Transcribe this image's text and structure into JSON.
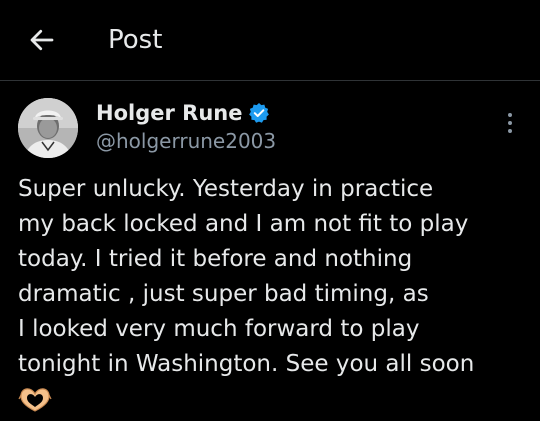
{
  "header": {
    "title": "Post",
    "back_icon": "arrow-left-icon"
  },
  "author": {
    "display_name": "Holger Rune",
    "handle": "@holgerrune2003",
    "verified": true,
    "verified_color": "#1d9bf0"
  },
  "post": {
    "text": "Super unlucky. Yesterday in practice\nmy back locked and I am not fit to play\ntoday. I tried it before and nothing\ndramatic , just super bad timing, as\nI looked very much forward to play\ntonight in Washington. See you all soon",
    "emoji": "heart-hands-emoji"
  },
  "colors": {
    "background": "#000000",
    "text": "#e7e9ea",
    "secondary_text": "#8b98a5",
    "divider": "#2f3336"
  }
}
